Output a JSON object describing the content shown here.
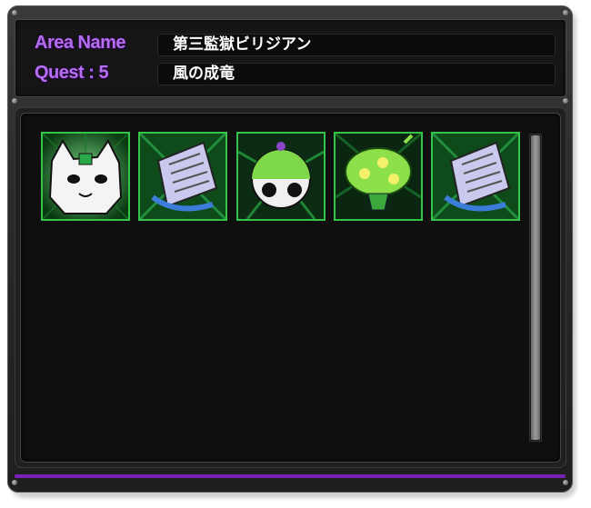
{
  "header": {
    "area_label": "Area Name",
    "area_value": "第三監獄ビリジアン",
    "quest_label": "Quest : 5",
    "quest_value": "風の成竜"
  },
  "monsters": [
    {
      "icon": "white-cat-monster-icon"
    },
    {
      "icon": "newspaper-monster-icon"
    },
    {
      "icon": "panda-ball-monster-icon"
    },
    {
      "icon": "green-mushroom-monster-icon"
    },
    {
      "icon": "newspaper-monster-icon"
    }
  ],
  "colors": {
    "label": "#b46ef0",
    "card_border": "#34c44a",
    "accent_bar": "#7a22b8"
  }
}
